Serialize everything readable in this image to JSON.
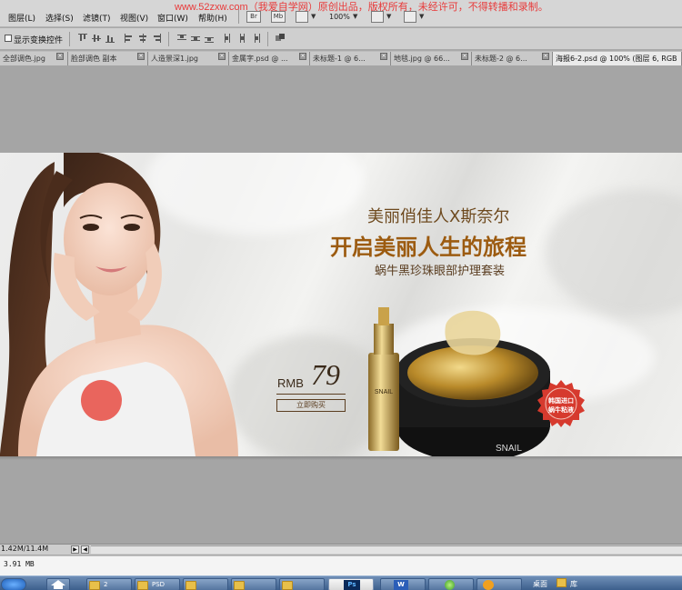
{
  "watermark": "www.52zxw.com（我爱自学网）原创出品，版权所有，未经许可，不得转播和录制。",
  "menu": [
    {
      "label": "图层(L)"
    },
    {
      "label": "选择(S)"
    },
    {
      "label": "滤镜(T)"
    },
    {
      "label": "视图(V)"
    },
    {
      "label": "窗口(W)"
    },
    {
      "label": "帮助(H)"
    }
  ],
  "toolbar": {
    "bridge_label": "Br",
    "minibridge_label": "Mb",
    "zoom": "100%"
  },
  "options_bar": {
    "show_transform_label": "显示变换控件",
    "show_transform_checked": false
  },
  "tabs": [
    {
      "label": "全部调色.jpg"
    },
    {
      "label": "脸部调色 副本"
    },
    {
      "label": "人造景深1.jpg"
    },
    {
      "label": "金属字.psd @ ..."
    },
    {
      "label": "未标题-1 @ 6..."
    },
    {
      "label": "地毯.jpg @ 66..."
    },
    {
      "label": "未标题-2 @ 6..."
    },
    {
      "label": "海报6-2.psd @ 100% (图层 6, RGB"
    }
  ],
  "banner": {
    "headline_1": "美丽俏佳人X斯奈尔",
    "headline_2": "开启美丽人生的旅程",
    "headline_3": "蜗牛黑珍珠眼部护理套装",
    "price_currency": "RMB",
    "price_value": "79",
    "buy_button": "立即购买",
    "seal_line1": "韩国进口",
    "seal_line2": "蜗牛粘液",
    "product_bottle_text": "SNAIL",
    "product_jar_text": "SNAIL"
  },
  "status": {
    "doc_size": "1.42M/11.4M",
    "info": "3.91 MB"
  },
  "taskbar": {
    "items": [
      {
        "label": "",
        "icon": "start-icon"
      },
      {
        "label": "",
        "icon": "show-desktop-icon"
      },
      {
        "label": "2",
        "icon": "folder-icon"
      },
      {
        "label": "PSD",
        "icon": "folder-icon"
      },
      {
        "label": "",
        "icon": "folder-icon"
      },
      {
        "label": "",
        "icon": "folder-icon"
      },
      {
        "label": "",
        "icon": "folder-icon"
      },
      {
        "label": "Ps",
        "icon": "photoshop-icon"
      },
      {
        "label": "W",
        "icon": "word-icon"
      },
      {
        "label": "",
        "icon": "browser-icon"
      },
      {
        "label": "",
        "icon": "qq-icon"
      }
    ],
    "tray_desktop": "桌面",
    "tray_library": "库"
  },
  "colors": {
    "menubar": "#d6d6d6",
    "canvas": "#a5a5a5",
    "headline_brown": "#9c5b10",
    "watermark_red": "#e83b3b",
    "seal_red": "#d63a2e",
    "gold": "#c9a24a"
  }
}
